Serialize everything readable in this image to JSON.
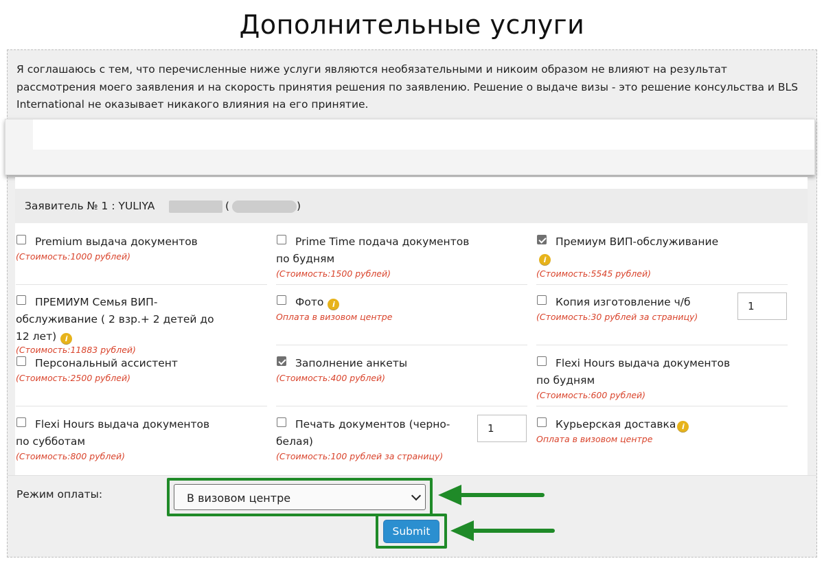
{
  "page": {
    "title": "Дополнительные услуги",
    "disclaimer": "Я соглашаюсь с тем, что перечисленные ниже услуги являются необязательными и никоим образом не влияют на результат рассмотрения моего заявления и на скорость принятия решения по заявлению. Решение о выдаче визы - это решение консульства и BLS International не оказывает никакого влияния на его принятие."
  },
  "applicant": {
    "label": "Заявитель № 1 : YULIYA",
    "paren_open": "(",
    "paren_close": ")"
  },
  "services": [
    {
      "name": "Premium выдача документов",
      "price": "(Стоимость:1000 рублей)",
      "checked": false,
      "info": false
    },
    {
      "name": "Prime Time подача документов по будням",
      "price": "(Стоимость:1500 рублей)",
      "checked": false,
      "info": false
    },
    {
      "name": "Премиум ВИП-обслуживание",
      "price": "(Стоимость:5545 рублей)",
      "checked": true,
      "info": true
    },
    {
      "name": "ПРЕМИУМ Семья ВИП-обслуживание ( 2 взр.+ 2 детей до 12 лет)",
      "price": "(Стоимость:11883 рублей)",
      "checked": false,
      "info": true
    },
    {
      "name": "Фото",
      "price": "Оплата в визовом центре",
      "checked": false,
      "info": true
    },
    {
      "name": "Копия изготовление ч/б",
      "price": "(Стоимость:30 рублей за страницу)",
      "checked": false,
      "info": false,
      "qty": "1"
    },
    {
      "name": "Персональный ассистент",
      "price": "(Стоимость:2500 рублей)",
      "checked": false,
      "info": false
    },
    {
      "name": "Заполнение анкеты",
      "price": "(Стоимость:400 рублей)",
      "checked": true,
      "info": false
    },
    {
      "name": "Flexi Hours выдача документов по будням",
      "price": "(Стоимость:600 рублей)",
      "checked": false,
      "info": false
    },
    {
      "name": "Flexi Hours выдача документов по субботам",
      "price": "(Стоимость:800 рублей)",
      "checked": false,
      "info": false
    },
    {
      "name": "Печать документов (черно-белая)",
      "price": "(Стоимость:100 рублей за страницу)",
      "checked": false,
      "info": false,
      "qty": "1"
    },
    {
      "name": "Курьерская доставка",
      "price": "Оплата в визовом центре",
      "checked": false,
      "info": true
    }
  ],
  "info_glyph": "i",
  "payment": {
    "label": "Режим оплаты:",
    "selected": "В визовом центре"
  },
  "submit": {
    "label": "Submit"
  },
  "colors": {
    "price_text": "#d9432b",
    "highlight_green": "#1f8a28",
    "submit_blue": "#2b8fd0",
    "info_icon": "#e7b31b"
  }
}
